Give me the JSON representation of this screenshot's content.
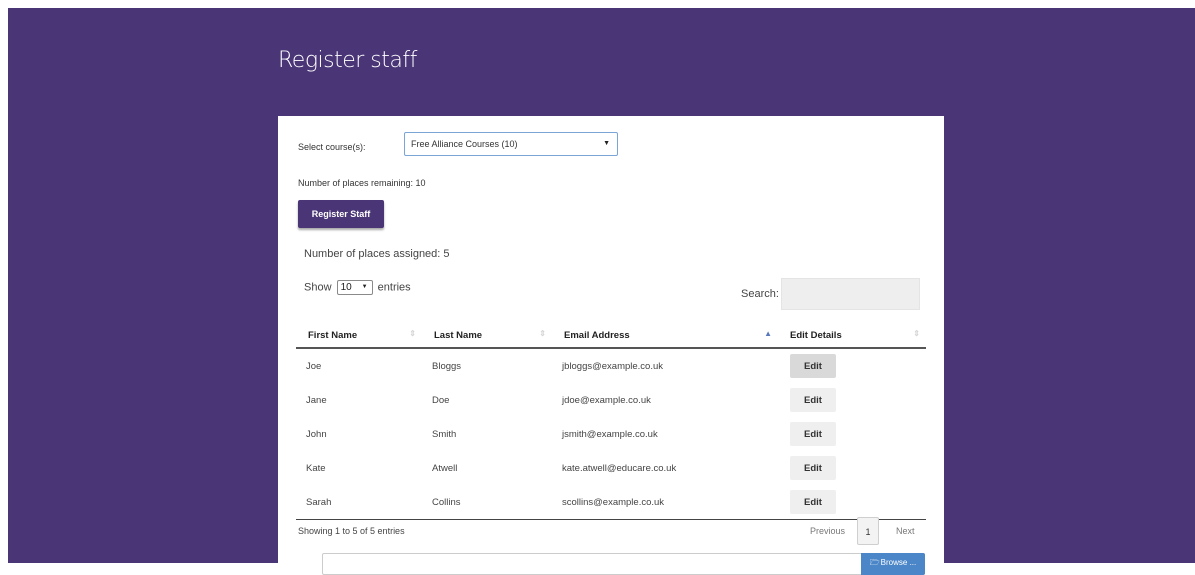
{
  "page": {
    "title": "Register staff"
  },
  "form": {
    "course_label": "Select course(s):",
    "course_value": "Free Alliance Courses (10)",
    "places_remaining": "Number of places remaining: 10",
    "register_button": "Register Staff"
  },
  "table_section": {
    "places_assigned": "Number of places assigned: 5",
    "show_label": "Show",
    "length_value": "10",
    "entries_label": "entries",
    "search_label": "Search:",
    "search_value": "",
    "columns": [
      "First Name",
      "Last Name",
      "Email Address",
      "Edit Details"
    ],
    "sorted_column": "Email Address",
    "rows": [
      {
        "first": "Joe",
        "last": "Bloggs",
        "email": "jbloggs@example.co.uk",
        "action": "Edit"
      },
      {
        "first": "Jane",
        "last": "Doe",
        "email": "jdoe@example.co.uk",
        "action": "Edit"
      },
      {
        "first": "John",
        "last": "Smith",
        "email": "jsmith@example.co.uk",
        "action": "Edit"
      },
      {
        "first": "Kate",
        "last": "Atwell",
        "email": "kate.atwell@educare.co.uk",
        "action": "Edit"
      },
      {
        "first": "Sarah",
        "last": "Collins",
        "email": "scollins@example.co.uk",
        "action": "Edit"
      }
    ],
    "info": "Showing 1 to 5 of 5 entries",
    "pagination": {
      "previous": "Previous",
      "current": "1",
      "next": "Next"
    }
  },
  "upload": {
    "browse_label": "Browse ..."
  },
  "icons": {
    "dropdown": "caret-down-icon",
    "sort": "sort-arrows-icon",
    "sort_ascending": "sort-up-icon",
    "browse": "folder-open-icon"
  },
  "colors": {
    "header_background": "#4a3677",
    "primary_button": "#4a3677",
    "browse_button": "#4a86c8",
    "card_background": "#ffffff"
  }
}
